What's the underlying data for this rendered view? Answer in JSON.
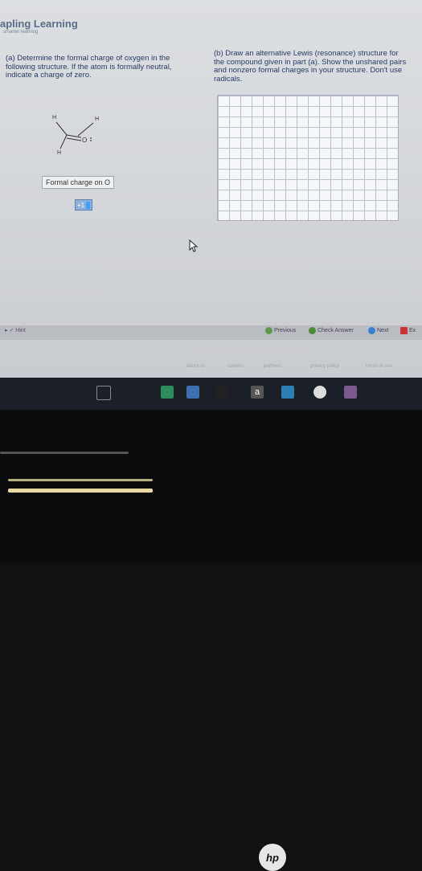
{
  "header": {
    "brand": "apling Learning",
    "brand_sub": "smarter learning"
  },
  "question_a": "(a) Determine the formal charge of oxygen in the following structure. If the atom is formally neutral, indicate a charge of zero.",
  "question_b": "(b) Draw an alternative Lewis (resonance) structure for the compound given in part (a). Show the unshared pairs and nonzero formal charges in your structure. Don't use radicals.",
  "molecule": {
    "h1": "H",
    "h2": "H",
    "h3": "H",
    "c": "C",
    "o": "O"
  },
  "formal_charge": {
    "label": "Formal charge on O",
    "value": "+1"
  },
  "hint": {
    "label": "Hint"
  },
  "nav": {
    "previous": "Previous",
    "check": "Check Answer",
    "next": "Next",
    "exit": "Ex"
  },
  "footer": {
    "about": "about us",
    "careers": "careers",
    "partners": "partners",
    "privacy": "privacy policy",
    "terms": "terms of use"
  },
  "taskbar": {
    "letter": "a"
  },
  "laptop": {
    "logo": "hp"
  },
  "colors": {
    "accent": "#4a8a3a",
    "next": "#3a7fd0"
  }
}
